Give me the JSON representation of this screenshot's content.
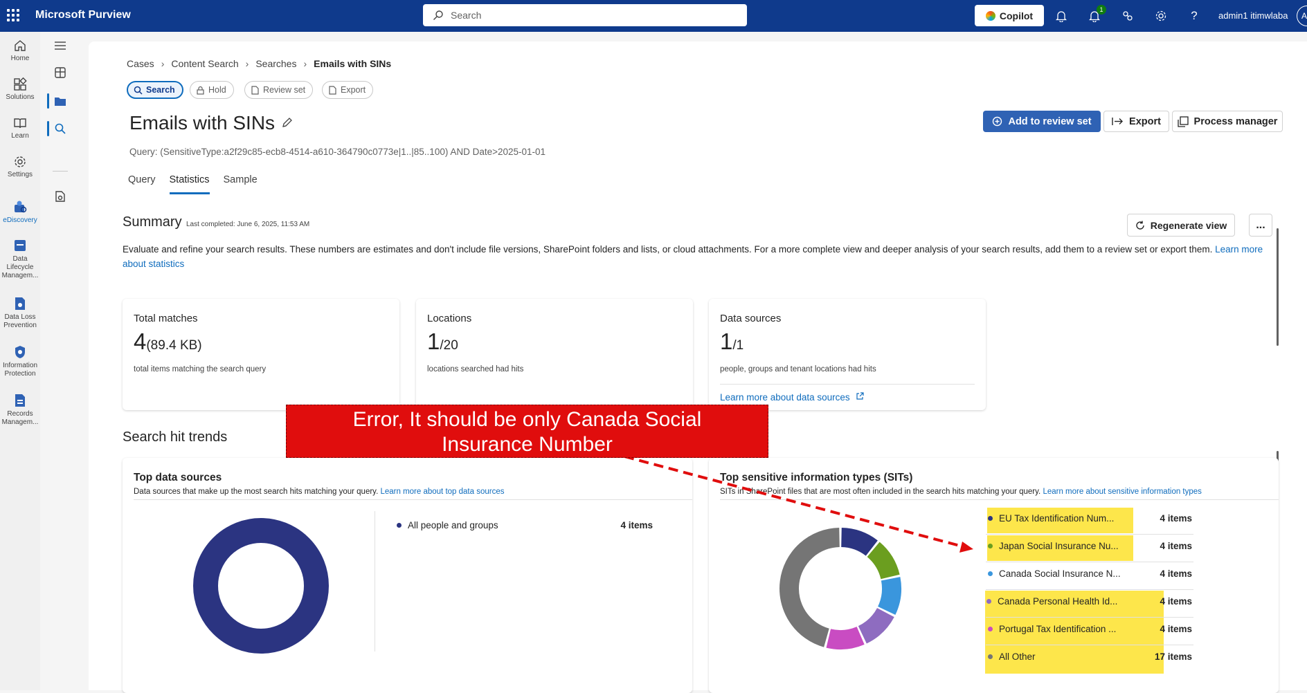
{
  "topbar": {
    "app_name": "Microsoft Purview",
    "search_placeholder": "Search",
    "copilot_label": "Copilot",
    "notification_count": "1",
    "user_name": "admin1 itimwlaba",
    "avatar_initials": "A"
  },
  "rail": {
    "items": [
      {
        "label": "Home",
        "icon": "home-icon"
      },
      {
        "label": "Solutions",
        "icon": "solutions-icon"
      },
      {
        "label": "Learn",
        "icon": "learn-icon"
      },
      {
        "label": "Settings",
        "icon": "settings-icon"
      },
      {
        "label": "eDiscovery",
        "icon": "ediscovery-icon"
      },
      {
        "label": "Data Lifecycle Managem...",
        "icon": "data-lifecycle-icon"
      },
      {
        "label": "Data Loss Prevention",
        "icon": "dlp-icon"
      },
      {
        "label": "Information Protection",
        "icon": "information-protection-icon"
      },
      {
        "label": "Records Managem...",
        "icon": "records-icon"
      }
    ]
  },
  "breadcrumb": [
    "Cases",
    "Content Search",
    "Searches",
    "Emails with SINs"
  ],
  "action_pills": [
    "Search",
    "Hold",
    "Review set",
    "Export"
  ],
  "page": {
    "title": "Emails with SINs",
    "query": "Query: (SensitiveType:a2f29c85-ecb8-4514-a610-364790c0773e|1..|85..100) AND Date>2025-01-01",
    "add_to_review_set": "Add to review set",
    "export": "Export",
    "process_manager": "Process manager"
  },
  "tabs": [
    "Query",
    "Statistics",
    "Sample"
  ],
  "summary": {
    "title": "Summary",
    "last_completed": "Last completed: June 6, 2025, 11:53 AM",
    "regenerate": "Regenerate view",
    "more": "...",
    "description": "Evaluate and refine your search results. These numbers are estimates and don't include file versions, SharePoint folders and lists, or cloud attachments. For a more complete view and deeper analysis of your search results, add them to a review set or export them.",
    "learn_more": "Learn more about statistics"
  },
  "cards": [
    {
      "title": "Total matches",
      "value": "4",
      "suffix": "(89.4 KB)",
      "desc": "total items matching the search query"
    },
    {
      "title": "Locations",
      "value": "1",
      "suffix": "/20",
      "desc": "locations searched had hits"
    },
    {
      "title": "Data sources",
      "value": "1",
      "suffix": "/1",
      "desc": "people, groups and tenant locations had hits",
      "link": "Learn more about data sources"
    }
  ],
  "trends": {
    "title": "Search hit trends",
    "top_sources": {
      "title": "Top data sources",
      "desc": "Data sources that make up the most search hits matching your query.",
      "link": "Learn more about top data sources",
      "legend": [
        {
          "label": "All people and groups",
          "value": "4 items",
          "color": "#2b3481"
        }
      ]
    },
    "top_sits": {
      "title": "Top sensitive information types (SITs)",
      "desc": "SITs in SharePoint files that are most often included in the search hits matching your query.",
      "link": "Learn more about sensitive information types",
      "legend": [
        {
          "label": "EU Tax Identification Num...",
          "value": "4 items",
          "color": "#2b3481"
        },
        {
          "label": "Japan Social Insurance Nu...",
          "value": "4 items",
          "color": "#6b9e1f"
        },
        {
          "label": "Canada Social Insurance N...",
          "value": "4 items",
          "color": "#3a96dd"
        },
        {
          "label": "Canada Personal Health Id...",
          "value": "4 items",
          "color": "#8e6cc0"
        },
        {
          "label": "Portugal Tax Identification ...",
          "value": "4 items",
          "color": "#c94cc2"
        },
        {
          "label": "All Other",
          "value": "17 items",
          "color": "#757575"
        }
      ]
    }
  },
  "chart_data": [
    {
      "type": "pie",
      "title": "Top data sources",
      "categories": [
        "All people and groups"
      ],
      "values": [
        4
      ]
    },
    {
      "type": "pie",
      "title": "Top sensitive information types (SITs)",
      "categories": [
        "EU Tax Identification Num...",
        "Japan Social Insurance Nu...",
        "Canada Social Insurance N...",
        "Canada Personal Health Id...",
        "Portugal Tax Identification ...",
        "All Other"
      ],
      "values": [
        4,
        4,
        4,
        4,
        4,
        17
      ]
    }
  ],
  "annotation": {
    "text_line1": "Error, It should be only Canada Social",
    "text_line2": "Insurance Number",
    "color": "#e00d0d"
  }
}
